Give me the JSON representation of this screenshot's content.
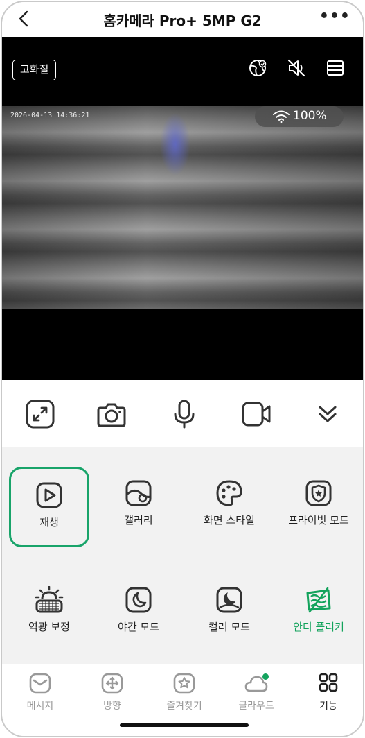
{
  "header": {
    "title": "홈카메라 Pro+ 5MP G2",
    "back_icon": "chevron-left-icon",
    "more_label": "•••"
  },
  "video": {
    "quality_label": "고화질",
    "timestamp": "2026-04-13 14:36:21",
    "signal_label": "100%",
    "top_icons": [
      "globe-icon",
      "mute-icon",
      "layout-icon"
    ]
  },
  "controls": [
    "fullscreen-icon",
    "camera-icon",
    "microphone-icon",
    "video-record-icon",
    "chevron-double-down-icon"
  ],
  "functions": [
    {
      "label": "재생",
      "icon": "play-icon",
      "selected": true
    },
    {
      "label": "갤러리",
      "icon": "gallery-icon"
    },
    {
      "label": "화면 스타일",
      "icon": "palette-icon"
    },
    {
      "label": "프라이빗 모드",
      "icon": "shield-icon"
    },
    {
      "label": "역광 보정",
      "icon": "backlight-icon"
    },
    {
      "label": "야간 모드",
      "icon": "moon-icon"
    },
    {
      "label": "컬러 모드",
      "icon": "color-mode-icon"
    },
    {
      "label": "안티 플리커",
      "icon": "anti-flicker-icon",
      "active": true
    }
  ],
  "colors": {
    "accent": "#13a35c",
    "selected_border": "#19a46a"
  },
  "nav": [
    {
      "label": "메시지",
      "icon": "message-icon"
    },
    {
      "label": "방향",
      "icon": "direction-icon"
    },
    {
      "label": "즐겨찾기",
      "icon": "favorite-icon"
    },
    {
      "label": "클라우드",
      "icon": "cloud-icon",
      "badge": true
    },
    {
      "label": "기능",
      "icon": "grid-icon",
      "current": true
    }
  ]
}
